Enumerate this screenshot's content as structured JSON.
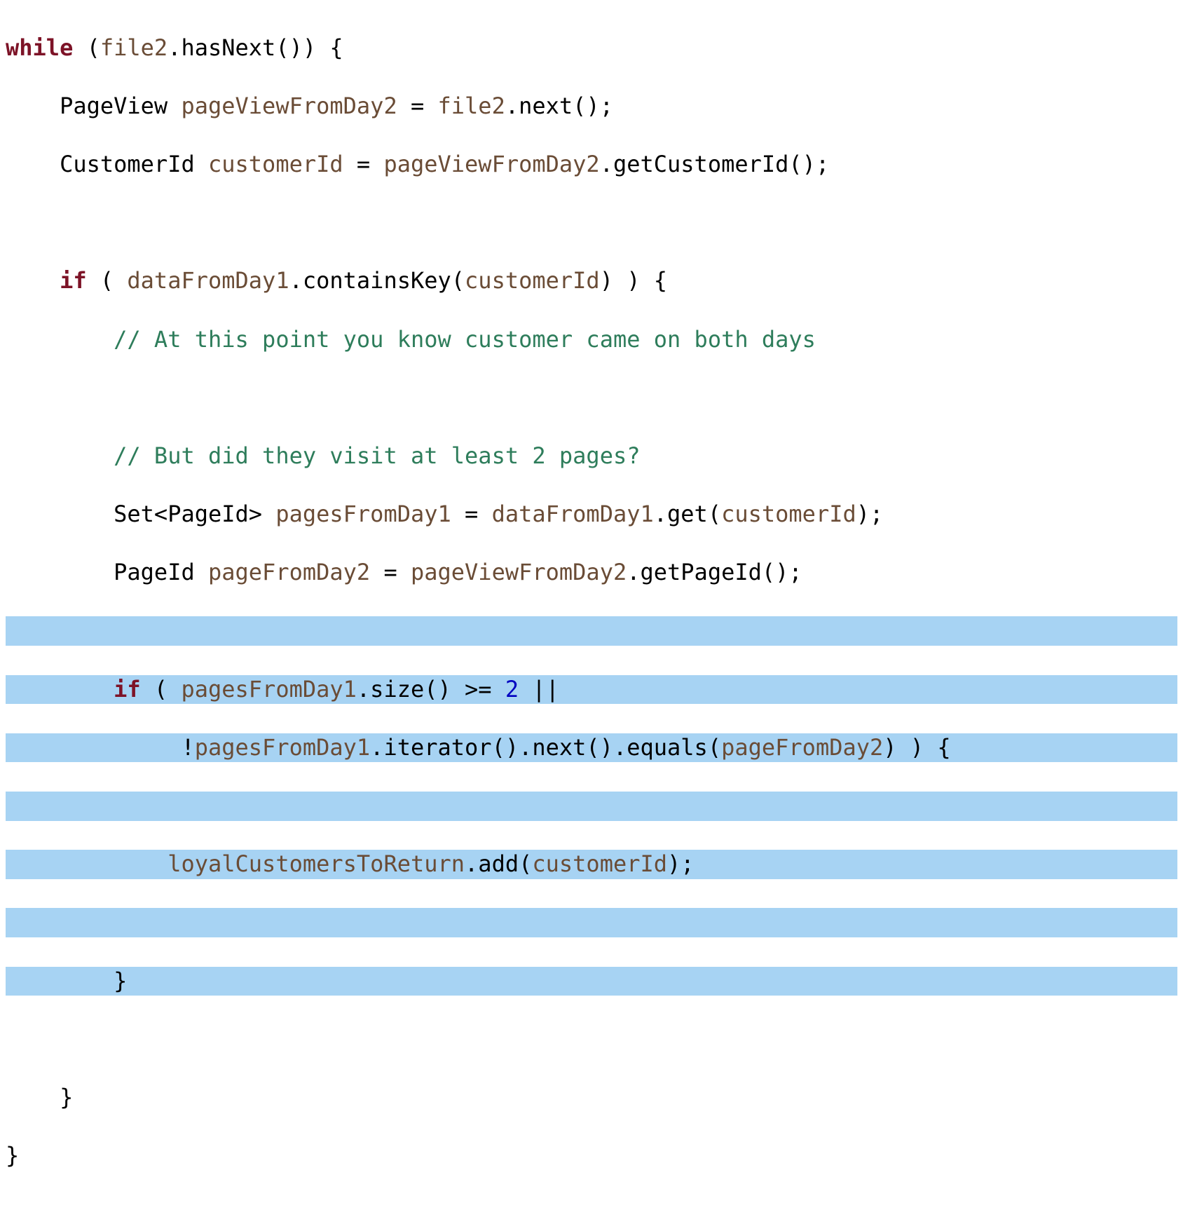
{
  "colors": {
    "keyword": "#7d1327",
    "identifier": "#6a4c36",
    "comment": "#2e7d5b",
    "highlight_bg": "#a7d3f3",
    "number": "#0000c0"
  },
  "code": {
    "l1": {
      "kw": "while",
      "p1": " (",
      "id1": "file2",
      "p2": ".",
      "m1": "hasNext",
      "p3": "()) {"
    },
    "l2": {
      "indent": "    ",
      "type": "PageView ",
      "id1": "pageViewFromDay2",
      "p1": " = ",
      "id2": "file2",
      "p2": ".",
      "m1": "next",
      "p3": "();"
    },
    "l3": {
      "indent": "    ",
      "type": "CustomerId ",
      "id1": "customerId",
      "p1": " = ",
      "id2": "pageViewFromDay2",
      "p2": ".",
      "m1": "getCustomerId",
      "p3": "();"
    },
    "l4": {
      "blank": " "
    },
    "l5": {
      "indent": "    ",
      "kw": "if",
      "p1": " ( ",
      "id1": "dataFromDay1",
      "p2": ".",
      "m1": "containsKey",
      "p3": "(",
      "id2": "customerId",
      "p4": ") ) {"
    },
    "l6": {
      "indent": "        ",
      "cmt": "// At this point you know customer came on both days"
    },
    "l7": {
      "blank": " "
    },
    "l8": {
      "indent": "        ",
      "cmt": "// But did they visit at least 2 pages?"
    },
    "l9": {
      "indent": "        ",
      "type": "Set<PageId> ",
      "id1": "pagesFromDay1",
      "p1": " = ",
      "id2": "dataFromDay1",
      "p2": ".",
      "m1": "get",
      "p3": "(",
      "id3": "customerId",
      "p4": ");"
    },
    "l10": {
      "indent": "        ",
      "type": "PageId ",
      "id1": "pageFromDay2",
      "p1": " = ",
      "id2": "pageViewFromDay2",
      "p2": ".",
      "m1": "getPageId",
      "p3": "();"
    },
    "l11": {
      "blank": " "
    },
    "l12": {
      "indent": "        ",
      "kw": "if",
      "p1": " ( ",
      "id1": "pagesFromDay1",
      "p2": ".",
      "m1": "size",
      "p3": "() >= ",
      "num": "2",
      "p4": " ||"
    },
    "l13": {
      "indent": "             ",
      "p1": "!",
      "id1": "pagesFromDay1",
      "p2": ".",
      "m1": "iterator",
      "p3": "().",
      "m2": "next",
      "p4": "().",
      "m3": "equals",
      "p5": "(",
      "id2": "pageFromDay2",
      "p6": ") ) {"
    },
    "l14": {
      "blank": " "
    },
    "l15": {
      "indent": "            ",
      "id1": "loyalCustomersToReturn",
      "p1": ".",
      "m1": "add",
      "p2": "(",
      "id2": "customerId",
      "p3": ");"
    },
    "l16": {
      "blank": " "
    },
    "l17": {
      "indent": "        ",
      "p1": "}"
    },
    "l18": {
      "blank": " "
    },
    "l19": {
      "indent": "    ",
      "p1": "}"
    },
    "l20": {
      "p1": "}"
    }
  }
}
